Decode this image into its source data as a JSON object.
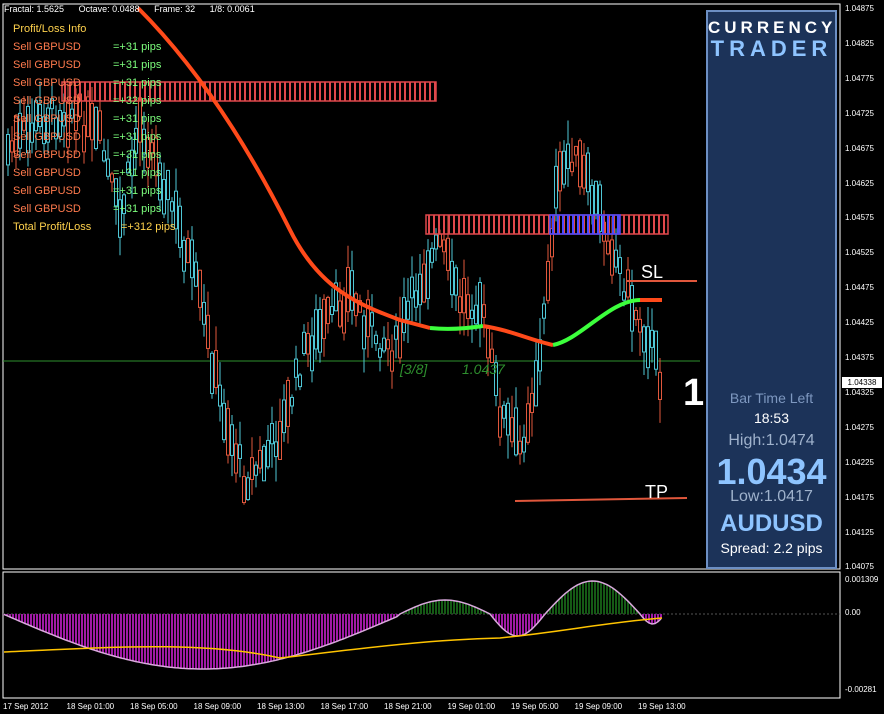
{
  "header": {
    "fractal": "Fractal: 1.5625",
    "octave": "Octave: 0.0488",
    "frame": "Frame: 32",
    "eighth": "1/8: 0.0061"
  },
  "pl_panel": {
    "title": "Profit/Loss Info",
    "rows": [
      {
        "symbol": "Sell GBPUSD",
        "value": "=+31 pips"
      },
      {
        "symbol": "Sell GBPUSD",
        "value": "=+31 pips"
      },
      {
        "symbol": "Sell GBPUSD",
        "value": "=+31 pips"
      },
      {
        "symbol": "Sell GBPUSD",
        "value": "=+32 pips"
      },
      {
        "symbol": "Sell GBPUSD",
        "value": "=+31 pips"
      },
      {
        "symbol": "Sell GBPUSD",
        "value": "=+31 pips"
      },
      {
        "symbol": "Sell GBPUSD",
        "value": "=+31 pips"
      },
      {
        "symbol": "Sell GBPUSD",
        "value": "=+31 pips"
      },
      {
        "symbol": "Sell GBPUSD",
        "value": "=+31 pips"
      },
      {
        "symbol": "Sell GBPUSD",
        "value": "=+31 pips"
      }
    ],
    "total_label": "Total Profit/Loss",
    "total_value": "=+312 pips"
  },
  "trader_panel": {
    "logo_line1": "CURRENCY",
    "logo_line2": "TRADER",
    "bar_time_left_label": "Bar Time Left",
    "bar_time_left_value": "18:53",
    "high": "High:1.0474",
    "price": "1.0434",
    "low": "Low:1.0417",
    "symbol": "AUDUSD",
    "spread": "Spread: 2.2 pips"
  },
  "chart_labels": {
    "sl": "SL",
    "tp": "TP",
    "one": "1",
    "murrey": "[3/8]",
    "murrey_price": "1.0437",
    "current_price": "1.04338"
  },
  "price_axis": [
    "1.04875",
    "1.04825",
    "1.04775",
    "1.04725",
    "1.04675",
    "1.04625",
    "1.04575",
    "1.04525",
    "1.04475",
    "1.04425",
    "1.04375",
    "1.04325",
    "1.04275",
    "1.04225",
    "1.04175",
    "1.04125",
    "1.04075"
  ],
  "osc_axis": [
    "0.001309",
    "0.00",
    "-0.00281"
  ],
  "time_axis": [
    "17 Sep 2012",
    "18 Sep 01:00",
    "18 Sep 05:00",
    "18 Sep 09:00",
    "18 Sep 13:00",
    "18 Sep 17:00",
    "18 Sep 21:00",
    "19 Sep 01:00",
    "19 Sep 05:00",
    "19 Sep 09:00",
    "19 Sep 13:00"
  ],
  "colors": {
    "bull": "#e0573c",
    "bear": "#4fc7d6",
    "ma_red": "#ff4a1a",
    "ma_green": "#3cff3c",
    "panel_bg": "#1c3359",
    "osc_neg": "#a01aa5",
    "osc_pos": "#155a15",
    "signal": "#ffc400"
  }
}
